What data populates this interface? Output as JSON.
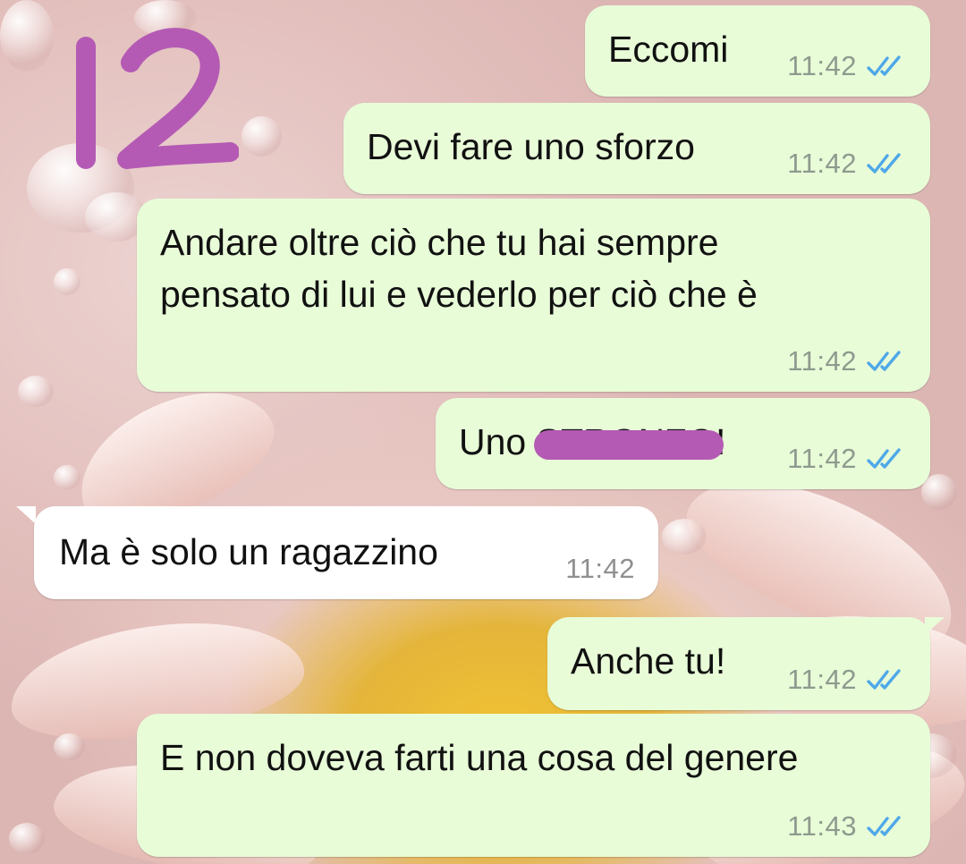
{
  "overlay": {
    "stamp_text": "12",
    "stamp_color": "#b45ab4"
  },
  "chat": {
    "outgoing_bubble_color": "#e8fcd8",
    "incoming_bubble_color": "#ffffff",
    "read_tick_color": "#4fa8e8",
    "read_icon": "double-check-icon",
    "messages": [
      {
        "direction": "outgoing",
        "text": "Eccomi",
        "time": "11:42",
        "status": "read"
      },
      {
        "direction": "outgoing",
        "text": "Devi fare uno sforzo",
        "time": "11:42",
        "status": "read"
      },
      {
        "direction": "outgoing",
        "text": "Andare oltre ciò che tu hai sempre\npensato di lui e vederlo per ciò che è",
        "time": "11:42",
        "status": "read"
      },
      {
        "direction": "outgoing",
        "text": "Uno STRONZO!",
        "time": "11:42",
        "status": "read",
        "redacted": true
      },
      {
        "direction": "incoming",
        "text": "Ma è solo un ragazzino",
        "time": "11:42"
      },
      {
        "direction": "outgoing",
        "text": "Anche tu!",
        "time": "11:42",
        "status": "read"
      },
      {
        "direction": "outgoing",
        "text": "E non doveva farti una cosa del genere",
        "time": "11:43",
        "status": "read"
      }
    ]
  }
}
